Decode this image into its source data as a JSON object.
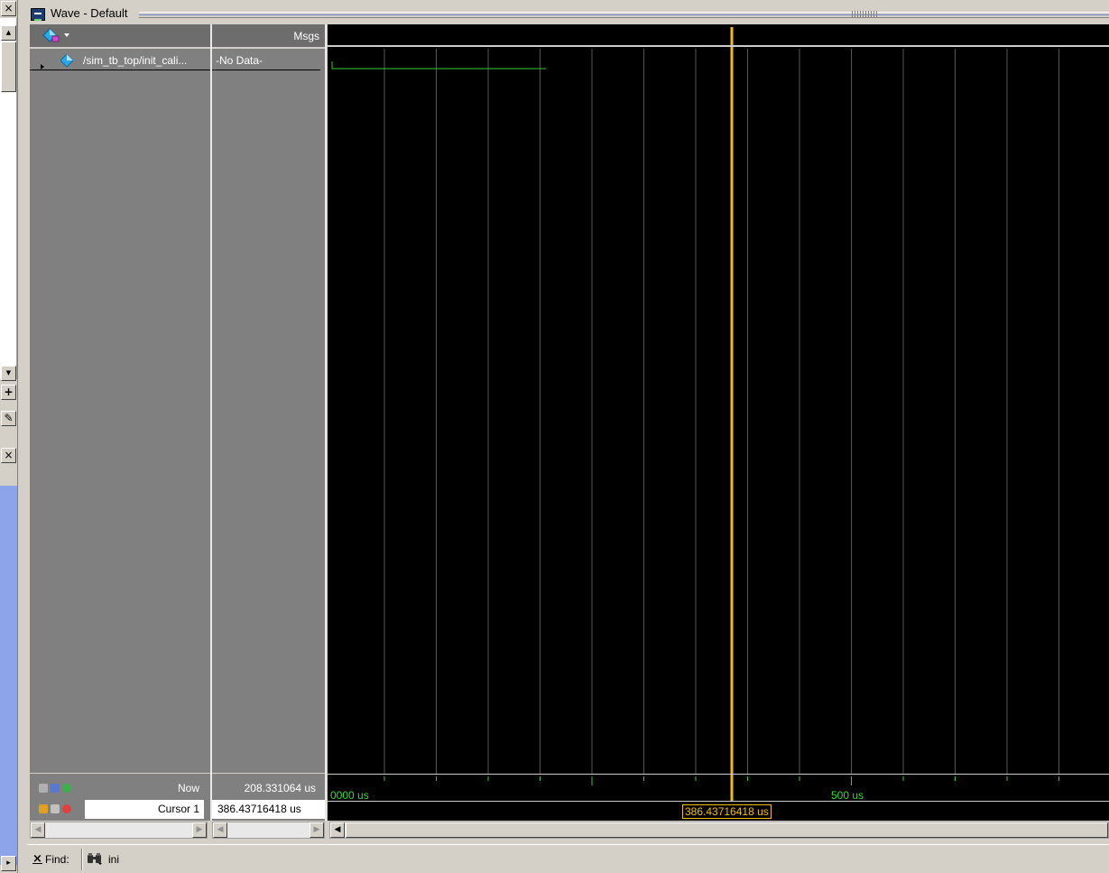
{
  "window": {
    "title": "Wave - Default"
  },
  "header": {
    "msgs_label": "Msgs"
  },
  "signals": [
    {
      "name": "/sim_tb_top/init_cali...",
      "value": "-No Data-"
    }
  ],
  "status": {
    "now_label": "Now",
    "now_value": "208.331064 us",
    "cursor_label": "Cursor 1",
    "cursor_value": "386.43716418 us"
  },
  "ruler": {
    "start_label": "0000 us",
    "mark_label": "500 us",
    "cursor_readout": "386.43716418 us"
  },
  "find": {
    "label": "Find:",
    "value": "ini"
  },
  "colors": {
    "wave_bg": "#000000",
    "grid": "#555555",
    "cursor": "#f0c000",
    "signal": "#33cc33"
  },
  "icons": {
    "left_close": "close-icon",
    "left_scroll_up": "arrow-up-icon",
    "left_scroll_down": "arrow-down-icon",
    "left_add": "plus-icon",
    "left_edit": "pencil-icon",
    "left_close_2": "close-icon",
    "scroll_left": "arrow-left-icon",
    "scroll_right": "arrow-right-icon"
  },
  "left_strip": {
    "close_1": "×",
    "up": "▲",
    "down": "▼",
    "plus": "+",
    "edit": "✎",
    "close_2": "×",
    "bottom_arrow": "▸"
  },
  "scroll_glyphs": {
    "left": "◀",
    "right": "▶"
  }
}
